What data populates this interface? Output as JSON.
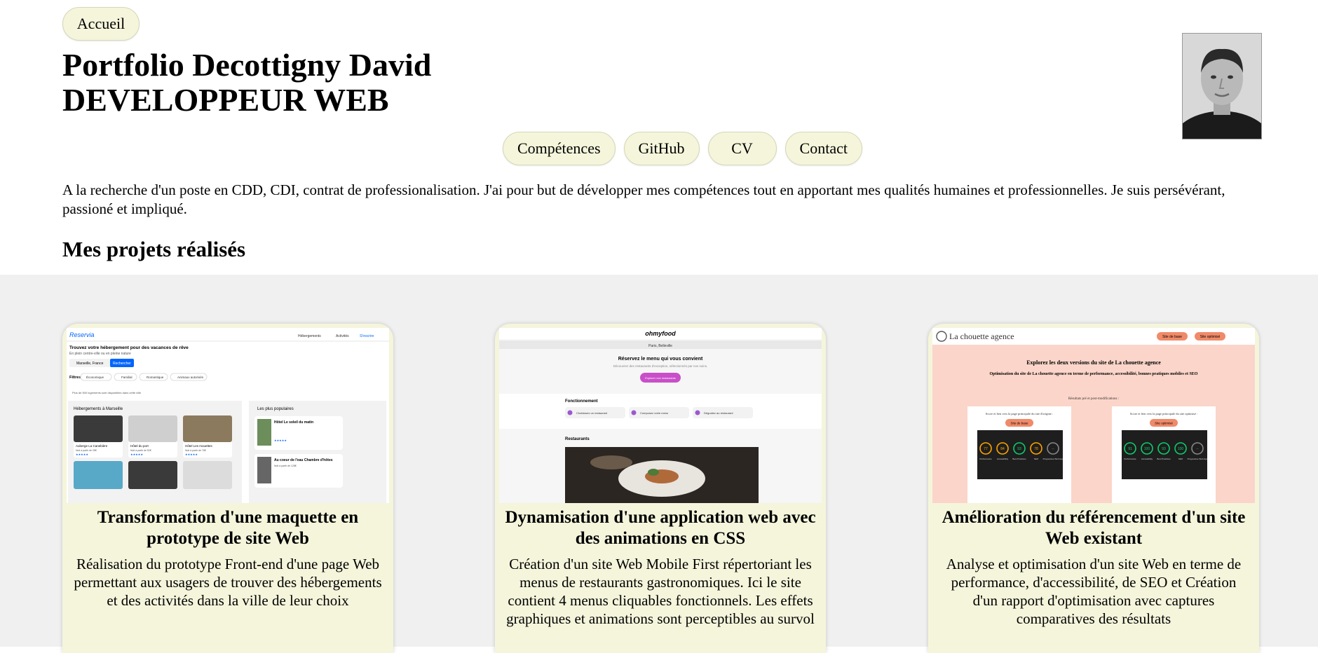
{
  "header": {
    "home_label": "Accueil",
    "title_line1": "Portfolio Decottigny David",
    "title_line2": "DEVELOPPEUR WEB"
  },
  "nav": {
    "competences": "Compétences",
    "github": "GitHub",
    "cv": "CV",
    "contact": "Contact"
  },
  "intro": "A la recherche d'un poste en CDD, CDI, contrat de professionalisation. J'ai pour but de développer mes compétences tout en apportant mes qualités humaines et professionnelles. Je suis persévérant, passioné et impliqué.",
  "projects_heading": "Mes projets réalisés",
  "colors": {
    "pill_bg": "#f5f5dc",
    "section_bg": "#f0f0f0",
    "card_bg": "#f5f5dc"
  },
  "projects": [
    {
      "title": "Transformation d'une maquette en prototype de site Web",
      "description": "Réalisation du prototype Front-end d'une page Web permettant aux usagers de trouver des hébergements et des activités dans la ville de leur choix",
      "thumb": {
        "logo": "Reservia",
        "nav": [
          "Hébergements",
          "Activités",
          "S'inscrire"
        ],
        "headline": "Trouvez votre hébergement pour des vacances de rêve",
        "subline": "En plein centre-ville ou en pleine nature",
        "search_value": "Marseille, France",
        "search_button": "Rechercher",
        "filters_label": "Filtres",
        "filters": [
          "Économique",
          "Familial",
          "Romantique",
          "Animaux autorisés"
        ],
        "info": "Plus de 500 logements sont disponibles dans cette ville",
        "section_title": "Hébergements à Marseille",
        "cards": [
          "Auberge La Canebière",
          "Hôtel du port",
          "Hôtel Les mouettes"
        ],
        "prices": [
          "Nuit à partir de 25€",
          "Nuit à partir de 52€",
          "Nuit à partir de 76€"
        ],
        "popular_title": "Les plus populaires",
        "popular": [
          "Hôtel Le soleil du matin",
          "Au coeur de l'eau Chambre d'hôtes"
        ],
        "popular_price": "Nuit à partir de 128€"
      }
    },
    {
      "title": "Dynamisation d'une application web avec des animations en CSS",
      "description": "Création d'un site Web Mobile First répertoriant les menus de restaurants gastronomiques. Ici le site contient 4 menus cliquables fonctionnels. Les effets graphiques et animations sont perceptibles au survol",
      "thumb": {
        "logo": "ohmyfood",
        "location": "Paris, Belleville",
        "headline": "Réservez le menu qui vous convient",
        "subline": "Découvrez des restaurants d'exception, sélectionnés par nos soins.",
        "cta": "Explorer nos restaurants",
        "section1": "Fonctionnement",
        "steps": [
          "Choisissez un restaurant",
          "Composez votre menu",
          "Dégustez au restaurant"
        ],
        "section2": "Restaurants"
      }
    },
    {
      "title": "Amélioration du référencement d'un site Web existant",
      "description": "Analyse et optimisation d'un site Web en terme de performance, d'accessibilité, de SEO et Création d'un rapport d'optimisation avec captures comparatives des résultats",
      "thumb": {
        "logo": "La chouette agence",
        "buttons": [
          "Site de base",
          "Site optimisé"
        ],
        "headline": "Explorez les deux versions du site de La chouette agence",
        "subline": "Optimisation du site de La chouette agence en terme de performance, accessibilité, bonnes pratiques mobiles et SEO",
        "results": "Résultats pré et post-modifications :",
        "panel_left": "Score et lien vers la page principale du site d'origine :",
        "panel_right": "Score et lien vers la page principale du site optimisé :",
        "scores_left": [
          "77",
          "84",
          "93",
          "78"
        ],
        "scores_right": [
          "91",
          "100",
          "93",
          "100"
        ],
        "score_labels": [
          "Performance",
          "Accessibility",
          "Best Practices",
          "SEO",
          "Progressive Web App"
        ]
      }
    }
  ]
}
